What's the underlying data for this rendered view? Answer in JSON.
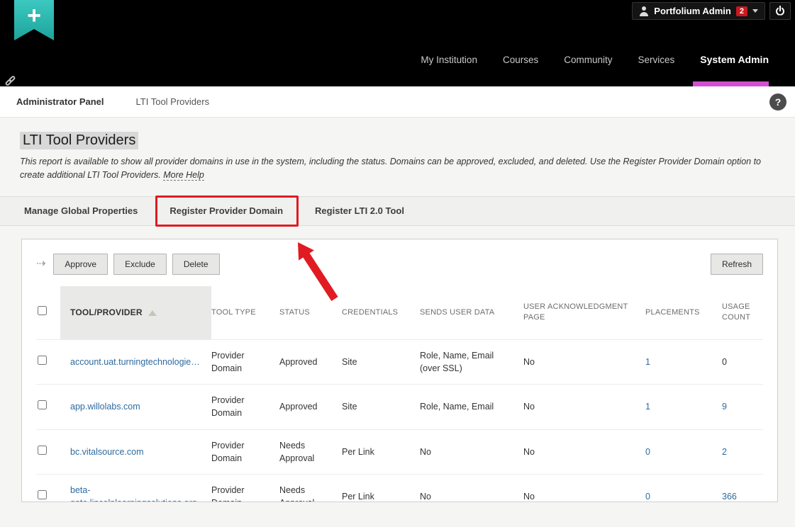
{
  "header": {
    "logo_plus": "+",
    "user_menu": {
      "label": "Portfolium Admin",
      "badge": "2"
    },
    "nav": [
      {
        "label": "My Institution"
      },
      {
        "label": "Courses"
      },
      {
        "label": "Community"
      },
      {
        "label": "Services"
      },
      {
        "label": "System Admin"
      }
    ]
  },
  "breadcrumb": {
    "primary": "Administrator Panel",
    "secondary": "LTI Tool Providers",
    "help_label": "?"
  },
  "page": {
    "title": "LTI Tool Providers",
    "description": "This report is available to show all provider domains in use in the system, including the status. Domains can be approved, excluded, and deleted. Use the Register Provider Domain option to create additional LTI Tool Providers.",
    "more_help_label": "More Help"
  },
  "tabs": [
    {
      "label": "Manage Global Properties"
    },
    {
      "label": "Register Provider Domain"
    },
    {
      "label": "Register LTI 2.0 Tool"
    }
  ],
  "toolbar": {
    "approve_label": "Approve",
    "exclude_label": "Exclude",
    "delete_label": "Delete",
    "refresh_label": "Refresh",
    "list_arrow_glyph": "⇢"
  },
  "table": {
    "headers": [
      "TOOL/PROVIDER",
      "TOOL TYPE",
      "STATUS",
      "CREDENTIALS",
      "SENDS USER DATA",
      "USER ACKNOWLEDGMENT PAGE",
      "PLACEMENTS",
      "USAGE COUNT"
    ],
    "rows": [
      {
        "tool_provider": "account.uat.turningtechnologie…",
        "tool_type": "Provider Domain",
        "status": "Approved",
        "credentials": "Site",
        "sends_user_data": "Role, Name, Email (over SSL)",
        "user_acknowledgment_page": "No",
        "placements": "1",
        "usage_count": "0"
      },
      {
        "tool_provider": "app.willolabs.com",
        "tool_type": "Provider Domain",
        "status": "Approved",
        "credentials": "Site",
        "sends_user_data": "Role, Name, Email",
        "user_acknowledgment_page": "No",
        "placements": "1",
        "usage_count": "9"
      },
      {
        "tool_provider": "bc.vitalsource.com",
        "tool_type": "Provider Domain",
        "status": "Needs Approval",
        "credentials": "Per Link",
        "sends_user_data": "No",
        "user_acknowledgment_page": "No",
        "placements": "0",
        "usage_count": "2"
      },
      {
        "tool_provider": "beta-gate.lincolnlearningsolutions.org",
        "tool_type": "Provider Domain",
        "status": "Needs Approval",
        "credentials": "Per Link",
        "sends_user_data": "No",
        "user_acknowledgment_page": "No",
        "placements": "0",
        "usage_count": "366"
      }
    ]
  },
  "colors": {
    "accent_teal": "#27b3ab",
    "accent_magenta": "#d24fd2",
    "annotation_red": "#e01b22",
    "link_blue": "#2d6a9e",
    "badge_red": "#c9181e"
  }
}
